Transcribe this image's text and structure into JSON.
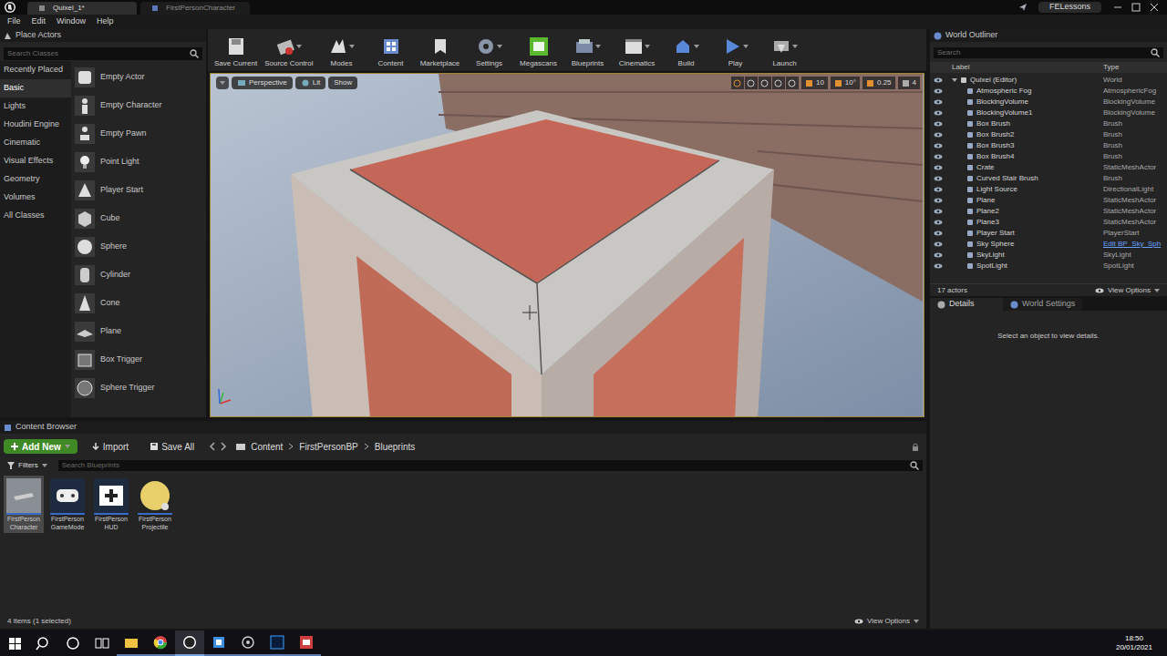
{
  "title_bar": {
    "tabs": [
      {
        "label": "Quixel_1*",
        "selected": true
      },
      {
        "label": "FirstPersonCharacter",
        "selected": false
      }
    ],
    "user": "FELessons"
  },
  "menu": [
    "File",
    "Edit",
    "Window",
    "Help"
  ],
  "place_actors": {
    "title": "Place Actors",
    "search_placeholder": "Search Classes",
    "categories": [
      {
        "label": "Recently Placed",
        "selected": false
      },
      {
        "label": "Basic",
        "selected": true
      },
      {
        "label": "Lights",
        "selected": false
      },
      {
        "label": "Houdini Engine",
        "selected": false
      },
      {
        "label": "Cinematic",
        "selected": false
      },
      {
        "label": "Visual Effects",
        "selected": false
      },
      {
        "label": "Geometry",
        "selected": false
      },
      {
        "label": "Volumes",
        "selected": false
      },
      {
        "label": "All Classes",
        "selected": false
      }
    ],
    "items": [
      "Empty Actor",
      "Empty Character",
      "Empty Pawn",
      "Point Light",
      "Player Start",
      "Cube",
      "Sphere",
      "Cylinder",
      "Cone",
      "Plane",
      "Box Trigger",
      "Sphere Trigger"
    ]
  },
  "toolbar": [
    {
      "label": "Save Current",
      "dropdown": false
    },
    {
      "label": "Source Control",
      "dropdown": true
    },
    {
      "label": "Modes",
      "dropdown": true
    },
    {
      "label": "Content",
      "dropdown": false
    },
    {
      "label": "Marketplace",
      "dropdown": false
    },
    {
      "label": "Settings",
      "dropdown": true
    },
    {
      "label": "Megascans",
      "dropdown": false
    },
    {
      "label": "Blueprints",
      "dropdown": true
    },
    {
      "label": "Cinematics",
      "dropdown": true
    },
    {
      "label": "Build",
      "dropdown": true
    },
    {
      "label": "Play",
      "dropdown": true
    },
    {
      "label": "Launch",
      "dropdown": true
    }
  ],
  "viewport": {
    "view_mode": "Perspective",
    "lighting": "Lit",
    "show": "Show",
    "grid_snap": "10",
    "rotation_snap": "10°",
    "scale_snap": "0.25",
    "camera_speed": "4"
  },
  "outliner": {
    "title": "World Outliner",
    "search_placeholder": "Search",
    "columns": [
      "Label",
      "Type"
    ],
    "root": {
      "label": "Quixel (Editor)",
      "type": "World",
      "expanded": true,
      "children": [
        {
          "label": "Atmospheric Fog",
          "type": "AtmosphericFog",
          "link": false
        },
        {
          "label": "BlockingVolume",
          "type": "BlockingVolume",
          "link": false
        },
        {
          "label": "BlockingVolume1",
          "type": "BlockingVolume",
          "link": false
        },
        {
          "label": "Box Brush",
          "type": "Brush",
          "link": false
        },
        {
          "label": "Box Brush2",
          "type": "Brush",
          "link": false
        },
        {
          "label": "Box Brush3",
          "type": "Brush",
          "link": false
        },
        {
          "label": "Box Brush4",
          "type": "Brush",
          "link": false
        },
        {
          "label": "Crate",
          "type": "StaticMeshActor",
          "link": false
        },
        {
          "label": "Curved Stair Brush",
          "type": "Brush",
          "link": false
        },
        {
          "label": "Light Source",
          "type": "DirectionalLight",
          "link": false
        },
        {
          "label": "Plane",
          "type": "StaticMeshActor",
          "link": false
        },
        {
          "label": "Plane2",
          "type": "StaticMeshActor",
          "link": false
        },
        {
          "label": "Plane3",
          "type": "StaticMeshActor",
          "link": false
        },
        {
          "label": "Player Start",
          "type": "PlayerStart",
          "link": false
        },
        {
          "label": "Sky Sphere",
          "type": "Edit BP_Sky_Sph",
          "link": true
        },
        {
          "label": "SkyLight",
          "type": "SkyLight",
          "link": false
        },
        {
          "label": "SpotLight",
          "type": "SpotLight",
          "link": false
        }
      ]
    },
    "count": "17 actors",
    "view_options": "View Options"
  },
  "details": {
    "tabs": [
      {
        "label": "Details",
        "selected": true
      },
      {
        "label": "World Settings",
        "selected": false
      }
    ],
    "message": "Select an object to view details."
  },
  "content_browser": {
    "title": "Content Browser",
    "add_new": "Add New",
    "import": "Import",
    "save_all": "Save All",
    "path": [
      "Content",
      "FirstPersonBP",
      "Blueprints"
    ],
    "filters": "Filters",
    "search_placeholder": "Search Blueprints",
    "assets": [
      {
        "lines": [
          "FirstPerson",
          "Character"
        ],
        "selected": true
      },
      {
        "lines": [
          "FirstPerson",
          "GameMode"
        ],
        "selected": false
      },
      {
        "lines": [
          "FirstPerson",
          "HUD"
        ],
        "selected": false
      },
      {
        "lines": [
          "FirstPerson",
          "Projectile"
        ],
        "selected": false
      }
    ],
    "status": "4 items (1 selected)",
    "view_options": "View Options"
  },
  "taskbar": {
    "time": "18:50",
    "date": "20/01/2021"
  }
}
